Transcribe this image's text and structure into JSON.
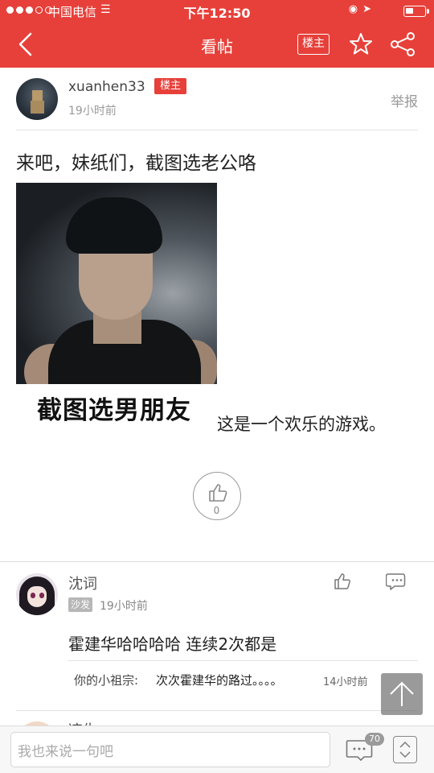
{
  "status_bar": {
    "carrier": "中国电信",
    "time": "下午12:50"
  },
  "nav": {
    "title": "看帖",
    "owner_only_label": "楼主"
  },
  "post": {
    "author": {
      "name": "xuanhen33",
      "badge": "楼主",
      "time": "19小时前"
    },
    "report_label": "举报",
    "title": "来吧，妹纸们，截图选老公咯",
    "image_caption": "截图选男朋友",
    "body": "这是一个欢乐的游戏。",
    "like_count": "0"
  },
  "comments": [
    {
      "author": "沈词",
      "floor": "沙发",
      "time": "19小时前",
      "text": "霍建华哈哈哈哈 连续2次都是",
      "reply": {
        "user": "你的小祖宗:",
        "text": "次次霍建华的路过。。。。",
        "time": "14小时前"
      }
    },
    {
      "author": "凉生"
    }
  ],
  "bottom_bar": {
    "input_placeholder": "我也来说一句吧",
    "comment_count": "70"
  },
  "colors": {
    "brand": "#e7403a",
    "muted": "#999999"
  }
}
